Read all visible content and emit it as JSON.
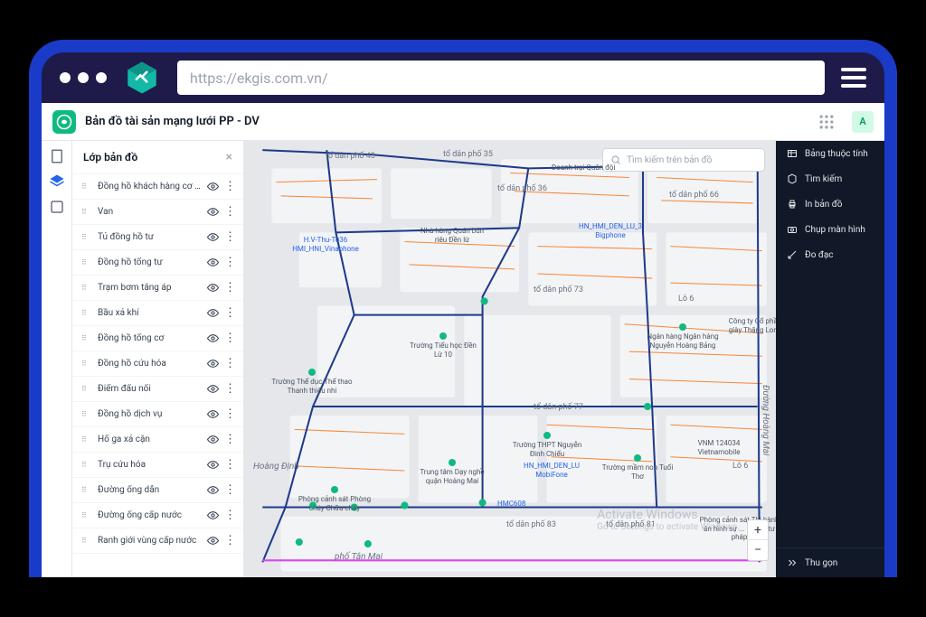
{
  "browser": {
    "url": "https://ekgis.com.vn/"
  },
  "header": {
    "title": "Bản đồ tài sản mạng lưới PP - DV",
    "user_initial": "A"
  },
  "layers_panel": {
    "title": "Lớp bản đồ",
    "items": [
      "Đồng hồ khách hàng cơ quan",
      "Van",
      "Tủ đồng hồ tư",
      "Đồng hồ tổng tư",
      "Trạm bơm tăng áp",
      "Bầu xả khí",
      "Đồng hồ tổng cơ",
      "Đồng hồ cứu hóa",
      "Điểm đấu nối",
      "Đồng hồ dịch vụ",
      "Hố ga xả cặn",
      "Trụ cứu hóa",
      "Đường ống dẫn",
      "Đường ống cấp nước",
      "Ranh giới vùng cấp nước"
    ]
  },
  "map": {
    "search_placeholder": "Tìm kiếm trên bản đồ",
    "zones": [
      "tổ dân phố 43",
      "tổ dân phố 35",
      "tổ dân phố 36",
      "tổ dân phố 66",
      "tổ dân phố 73",
      "Lô 6",
      "tổ dân phố 77",
      "tổ dân phố 83",
      "tổ dân phố 81",
      "Lô 6"
    ],
    "pois": [
      "Doanh trại Quân đội",
      "Nhà hàng Quán bún riêu Đền lừ",
      "Trường Tiểu học Đền Lừ 10",
      "Ngân hàng Ngân hàng Nguyễn Hoàng Bảng",
      "Công ty Cổ phần giày Thăng Long",
      "Trung tâm Dạy nghề quận Hoàng Mai",
      "Trường THPT Nguyễn Đình Chiểu",
      "Trường mầm non Tuổi Thơ",
      "VNM 124034 Vietnamobile",
      "Trường Thể dục Thể thao Thanh thiếu nhi",
      "Phòng cảnh sát Phòng cháy Chữa cháy",
      "Phòng cảnh sát Thi hành án hình sự ... Hỗ trợ tư pháp"
    ],
    "small_labels": [
      "H.V-Thu-Tu36 HMI_HNI_Vinaphone",
      "HN_HMI_DEN_LU_3 Bigphone",
      "HN_HMI_DEN_LU MobiFone",
      "HMC608"
    ],
    "roads": [
      "phố Tân Mai",
      "Hoàng Định",
      "Đường Hoàng Mai"
    ]
  },
  "right_panel": {
    "items": [
      "Bảng thuộc tính",
      "Tìm kiếm",
      "In bản đồ",
      "Chụp màn hình",
      "Đo đạc"
    ],
    "collapse": "Thu gọn"
  },
  "watermark": {
    "line1": "Activate Windows",
    "line2": "Go to Settings to activate Windows."
  }
}
